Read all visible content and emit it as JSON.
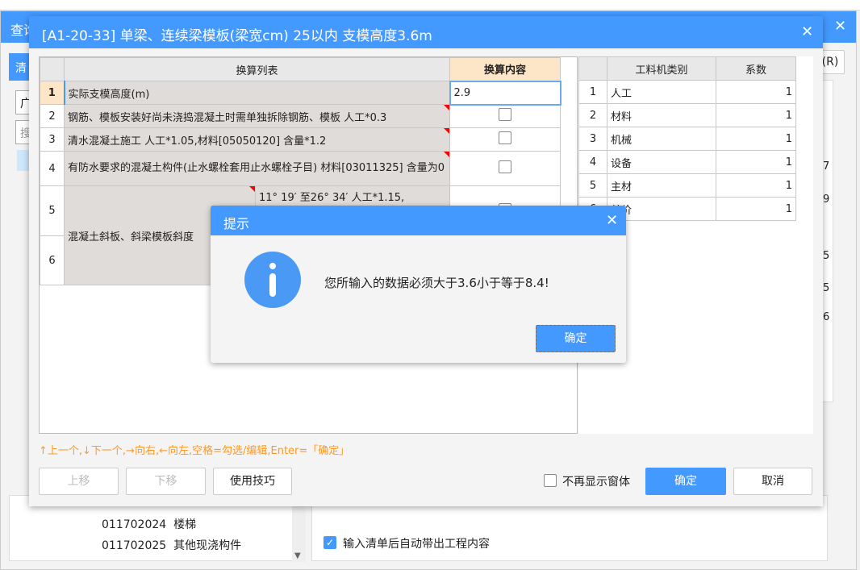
{
  "back_window": {
    "title": "查询",
    "tab": "清",
    "dropdown": "广",
    "search_placeholder": "搜",
    "r_button": "(R)",
    "right_nums": [
      "7",
      "9",
      "5",
      "5",
      "6"
    ],
    "list": [
      {
        "code": "011702024",
        "name": "楼梯"
      },
      {
        "code": "011702025",
        "name": "其他现浇构件"
      }
    ],
    "auto_checkbox": {
      "label": "输入清单后自动带出工程内容",
      "checked": true
    }
  },
  "dialog": {
    "title": "[A1-20-33] 单梁、连续梁模板(梁宽cm) 25以内 支模高度3.6m",
    "left_grid": {
      "headers": [
        "换算列表",
        "换算内容"
      ],
      "rows": [
        {
          "n": "1",
          "text": "实际支模高度(m)",
          "value": "2.9"
        },
        {
          "n": "2",
          "text": "钢筋、模板安装好尚未浇捣混凝土时需单独拆除钢筋、模板 人工*0.3",
          "checked": false
        },
        {
          "n": "3",
          "text": "清水混凝土施工 人工*1.05,材料[05050120] 含量*1.2",
          "checked": false
        },
        {
          "n": "4",
          "text": "有防水要求的混凝土构件(止水螺栓套用止水螺栓子目) 材料[03011325] 含量为0",
          "checked": false
        },
        {
          "n": "5",
          "text": "11° 19′ 至26° 34′  人工*1.15,",
          "checked": false
        },
        {
          "n": "6",
          "text": ""
        }
      ],
      "merged_text": "混凝土斜板、斜梁模板斜度"
    },
    "right_grid": {
      "headers": [
        "工料机类别",
        "系数"
      ],
      "rows": [
        {
          "n": "1",
          "name": "人工",
          "coef": "1"
        },
        {
          "n": "2",
          "name": "材料",
          "coef": "1"
        },
        {
          "n": "3",
          "name": "机械",
          "coef": "1"
        },
        {
          "n": "4",
          "name": "设备",
          "coef": "1"
        },
        {
          "n": "5",
          "name": "主材",
          "coef": "1"
        },
        {
          "n": "6",
          "name": "单价",
          "coef": "1"
        }
      ]
    },
    "hint": "↑上一个,↓下一个,→向右,←向左,空格=勾选/编辑,Enter=「确定」",
    "buttons": {
      "up": "上移",
      "down": "下移",
      "tips": "使用技巧",
      "no_show": "不再显示窗体",
      "ok": "确定",
      "cancel": "取消"
    }
  },
  "prompt": {
    "title": "提示",
    "message": "您所输入的数据必须大于3.6小于等于8.4!",
    "ok": "确定",
    "icon": "info-icon"
  },
  "colors": {
    "accent": "#4499ff",
    "hint": "#ff9922",
    "header_highlight": "#fde6c8"
  }
}
